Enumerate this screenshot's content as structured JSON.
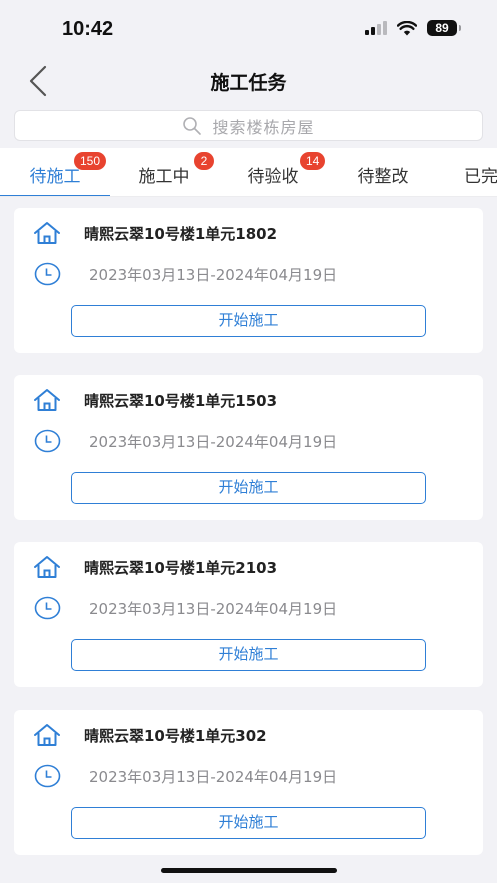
{
  "status_bar": {
    "time": "10:42",
    "battery": "89"
  },
  "nav": {
    "title": "施工任务",
    "back_icon": "chevron-left-icon"
  },
  "search": {
    "placeholder": "搜索楼栋房屋",
    "icon": "search-icon"
  },
  "tabs": [
    {
      "label": "待施工",
      "badge": "150",
      "active": true
    },
    {
      "label": "施工中",
      "badge": "2",
      "active": false
    },
    {
      "label": "待验收",
      "badge": "14",
      "active": false
    },
    {
      "label": "待整改",
      "badge": "",
      "active": false
    },
    {
      "label": "已完",
      "badge": "",
      "active": false
    }
  ],
  "tasks": [
    {
      "title": "晴熙云翠10号楼1单元1802",
      "date_range": "2023年03月13日-2024年04月19日",
      "action": "开始施工"
    },
    {
      "title": "晴熙云翠10号楼1单元1503",
      "date_range": "2023年03月13日-2024年04月19日",
      "action": "开始施工"
    },
    {
      "title": "晴熙云翠10号楼1单元2103",
      "date_range": "2023年03月13日-2024年04月19日",
      "action": "开始施工"
    },
    {
      "title": "晴熙云翠10号楼1单元302",
      "date_range": "2023年03月13日-2024年04月19日",
      "action": "开始施工"
    }
  ],
  "colors": {
    "accent": "#2f7fd6",
    "badge": "#e8432f",
    "background": "#f2f2f6"
  }
}
